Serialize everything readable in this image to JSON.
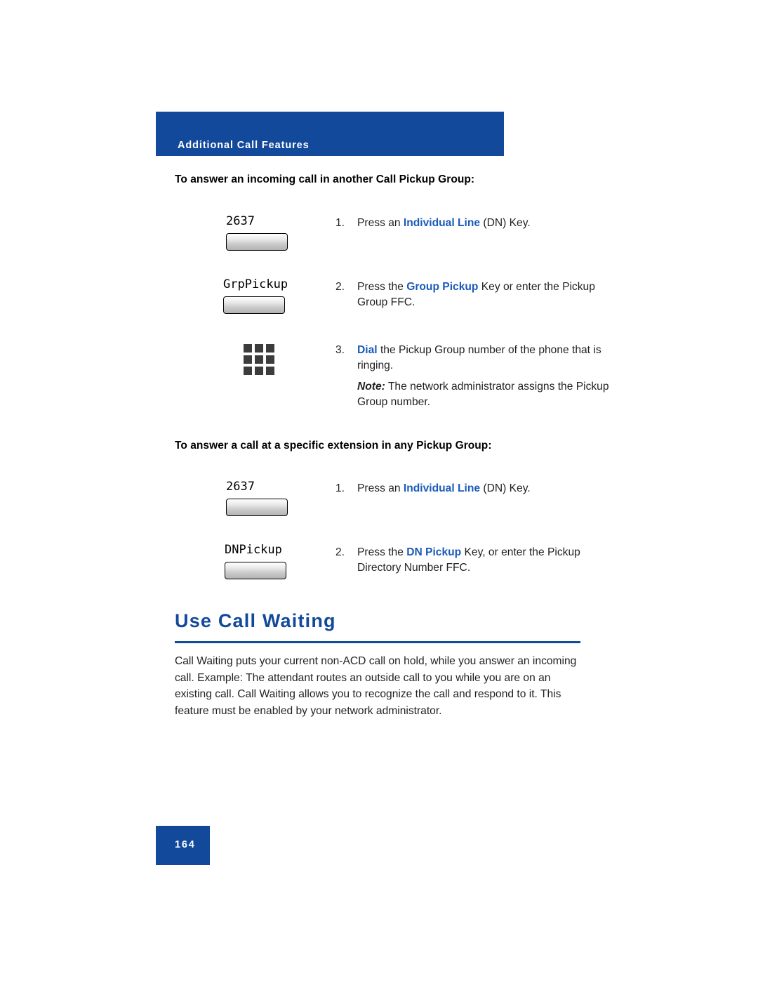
{
  "header": {
    "title": "Additional Call Features"
  },
  "sections": [
    {
      "heading": "To answer an incoming call in another Call Pickup Group:",
      "steps": [
        {
          "number": "1.",
          "text_before": "Press an ",
          "highlight": "Individual Line",
          "text_after": " (DN) Key.",
          "key_label": "2637",
          "key_type": "softkey"
        },
        {
          "number": "2.",
          "text_before": "Press the ",
          "highlight": "Group Pickup",
          "text_after": " Key or enter the Pickup Group FFC.",
          "key_label": "GrpPickup",
          "key_type": "softkey"
        },
        {
          "number": "3.",
          "text_before": "",
          "highlight": "Dial",
          "text_after": " the Pickup Group number of the phone that is ringing.",
          "note_label": "Note:",
          "note_text": " The network administrator assigns the Pickup Group number.",
          "key_label": "",
          "key_type": "keypad-icon"
        }
      ]
    },
    {
      "heading": "To answer a call at a specific extension in any Pickup Group:",
      "steps": [
        {
          "number": "1.",
          "text_before": "Press an ",
          "highlight": "Individual Line",
          "text_after": " (DN) Key.",
          "key_label": "2637",
          "key_type": "softkey"
        },
        {
          "number": "2.",
          "text_before": "Press the ",
          "highlight": "DN Pickup",
          "text_after": " Key, or enter the Pickup Directory Number FFC.",
          "key_label": "DNPickup",
          "key_type": "softkey"
        }
      ]
    }
  ],
  "feature": {
    "title": "Use Call Waiting",
    "body": "Call Waiting puts your current non-ACD call on hold, while you answer an incoming call. Example: The attendant routes an outside call to you while you are on an existing call. Call Waiting allows you to recognize the call and respond to it. This feature must be enabled by your network administrator."
  },
  "footer": {
    "page_number": "164"
  },
  "colors": {
    "brand_blue": "#13499b",
    "link_blue": "#1a5bb8"
  }
}
